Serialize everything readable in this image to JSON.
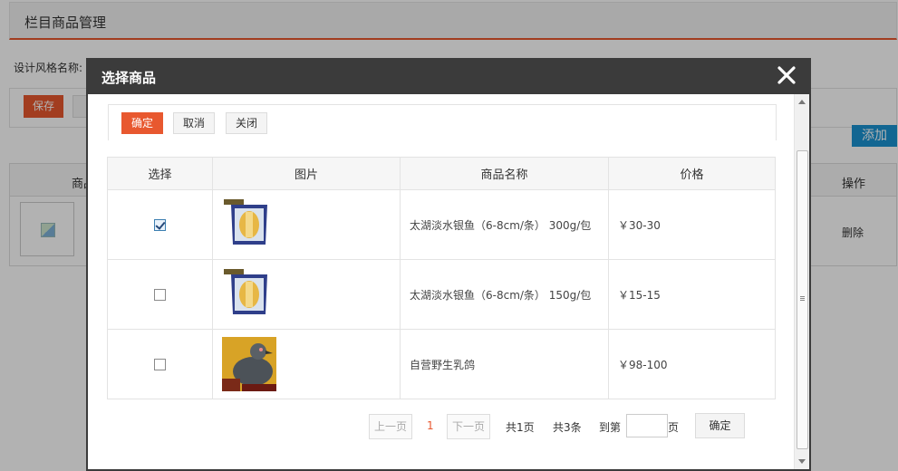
{
  "background_page": {
    "title": "栏目商品管理",
    "style_name_label": "设计风格名称:",
    "save_label": "保存",
    "add_label": "添加",
    "col_goods": "商品",
    "col_operation": "操作",
    "delete_label": "删除"
  },
  "dialog": {
    "title": "选择商品",
    "close_icon": "close-icon",
    "toolbar": {
      "confirm_label": "确定",
      "cancel_label": "取消",
      "close_label": "关闭"
    },
    "table": {
      "headers": [
        "选择",
        "图片",
        "商品名称",
        "价格"
      ],
      "rows": [
        {
          "checked": true,
          "image": "fish-package",
          "name": "太湖淡水银鱼（6-8cm/条） 300g/包",
          "price": "￥30-30"
        },
        {
          "checked": false,
          "image": "fish-package",
          "name": "太湖淡水银鱼（6-8cm/条） 150g/包",
          "price": "￥15-15"
        },
        {
          "checked": false,
          "image": "pigeon-photo",
          "name": "自营野生乳鸽",
          "price": "￥98-100"
        }
      ]
    },
    "pager": {
      "prev_label": "上一页",
      "current_page": "1",
      "next_label": "下一页",
      "total_pages": "共1页",
      "total_items": "共3条",
      "goto_prefix": "到第",
      "goto_suffix": "页",
      "goto_value": "",
      "confirm_label": "确定"
    }
  },
  "colors": {
    "accent": "#e8582f",
    "dialog_header": "#3b3b3b",
    "add_button": "#1a93d1"
  }
}
